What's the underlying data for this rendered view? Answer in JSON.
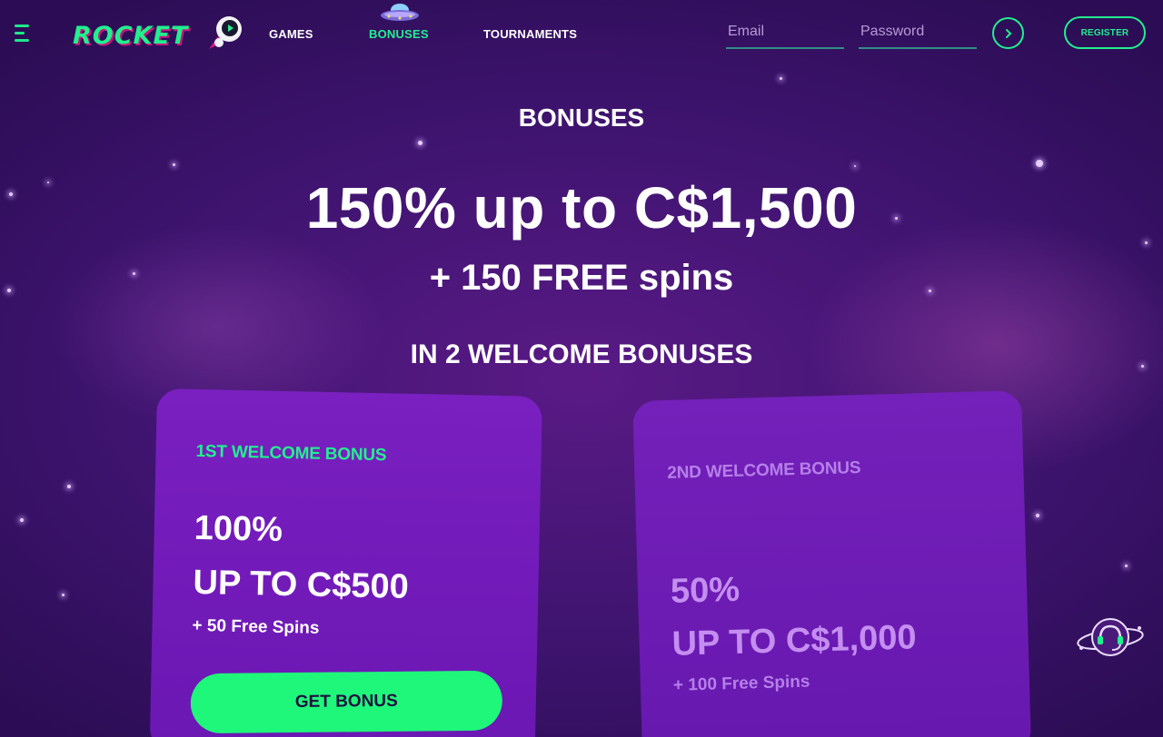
{
  "header": {
    "logo_text": "ROCKET",
    "nav": [
      {
        "label": "GAMES"
      },
      {
        "label": "BONUSES",
        "active": true
      },
      {
        "label": "TOURNAMENTS"
      }
    ],
    "email_placeholder": "Email",
    "password_placeholder": "Password",
    "register_label": "REGISTER"
  },
  "hero": {
    "page_title": "BONUSES",
    "headline": "150% up to C$1,500",
    "subheadline": "+ 150 FREE spins",
    "welcome_title": "IN 2 WELCOME BONUSES"
  },
  "cards": [
    {
      "label": "1ST WELCOME BONUS",
      "percent": "100%",
      "amount": "UP TO C$500",
      "spins": "+ 50 Free Spins",
      "button_label": "GET BONUS"
    },
    {
      "label": "2ND WELCOME BONUS",
      "percent": "50%",
      "amount": "UP TO C$1,000",
      "spins": "+ 100 Free Spins"
    }
  ],
  "colors": {
    "accent_green": "#21f08e",
    "background": "#3f1470",
    "card": "#7a1fc0",
    "button_green": "#1ff77a"
  },
  "icons": [
    "menu-icon",
    "astronaut-icon",
    "ufo-icon",
    "arrow-right-icon",
    "support-headset-icon"
  ]
}
